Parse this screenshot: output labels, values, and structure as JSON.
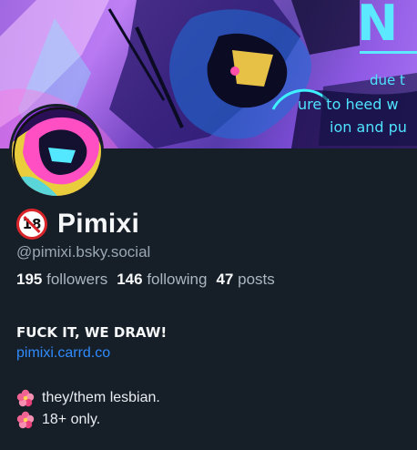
{
  "banner": {
    "big_text": "N",
    "line1": "due t",
    "line2": "ure to heed w",
    "line3": "ion and pu"
  },
  "profile": {
    "badge_text": "18",
    "display_name": "Pimixi",
    "handle": "@pimixi.bsky.social"
  },
  "stats": [
    {
      "value": "195",
      "label": "followers"
    },
    {
      "value": "146",
      "label": "following"
    },
    {
      "value": "47",
      "label": "posts"
    }
  ],
  "bio": {
    "title": "FUCK IT, WE DRAW!",
    "link": "pimixi.carrd.co",
    "lines": [
      "they/them lesbian.",
      "18+ only."
    ]
  },
  "icons": {
    "badge": "no-under-18-icon",
    "bullet": "hibiscus-flower-icon"
  },
  "colors": {
    "background": "#161e27",
    "link": "#2f8bff",
    "muted": "#9aa7b4",
    "badge_red": "#d9252a"
  }
}
